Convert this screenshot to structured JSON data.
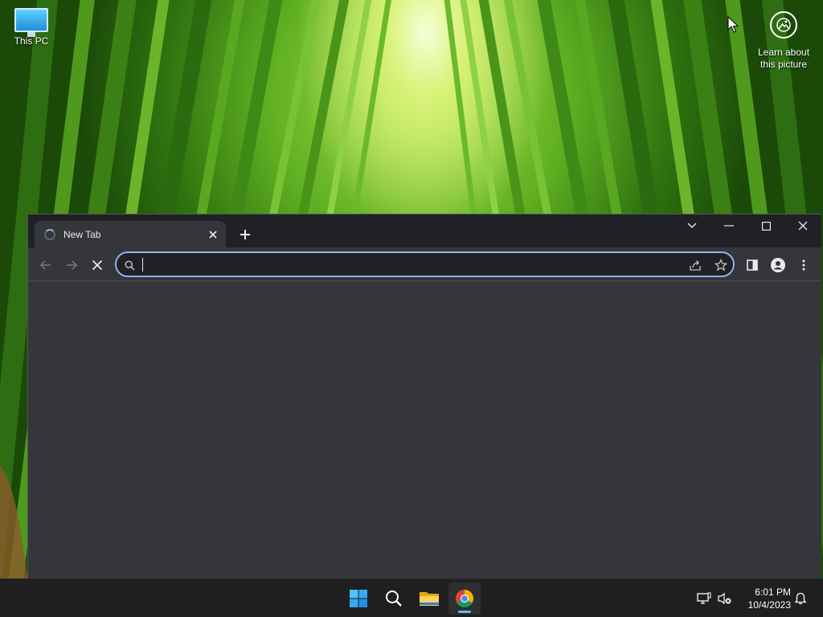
{
  "desktop": {
    "icons": [
      {
        "label": "This PC",
        "icon": "monitor-icon"
      }
    ],
    "learn_about": "Learn about this picture"
  },
  "browser": {
    "tabs": [
      {
        "title": "New Tab",
        "loading": true,
        "active": true
      }
    ],
    "omnibox": {
      "value": "",
      "placeholder": ""
    },
    "colors": {
      "accent": "#8ab4f8",
      "frame": "#202124",
      "toolbar": "#35363a"
    }
  },
  "taskbar": {
    "apps": [
      {
        "name": "Start",
        "icon": "windows-start-icon"
      },
      {
        "name": "Search",
        "icon": "search-icon"
      },
      {
        "name": "File Explorer",
        "icon": "folder-icon"
      },
      {
        "name": "Google Chrome",
        "icon": "chrome-icon",
        "active": true
      }
    ],
    "clock": {
      "time": "6:01 PM",
      "date": "10/4/2023"
    }
  }
}
